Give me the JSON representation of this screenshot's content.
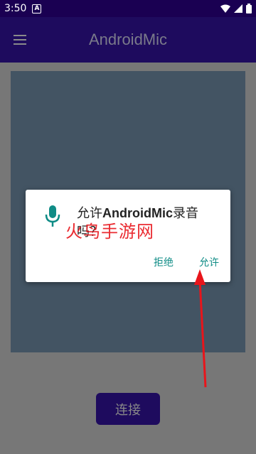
{
  "status_bar": {
    "time": "3:50",
    "notification_icon": "a-badge-icon",
    "icons": [
      "wifi-icon",
      "signal-icon",
      "battery-icon"
    ]
  },
  "app_bar": {
    "title": "AndroidMic",
    "menu_icon": "hamburger-menu-icon"
  },
  "dialog": {
    "icon": "microphone-icon",
    "message_prefix": "允许",
    "message_app": "AndroidMic",
    "message_suffix": "录音吗？",
    "deny_label": "拒绝",
    "allow_label": "允许"
  },
  "main": {
    "connect_label": "连接"
  },
  "overlay": {
    "watermark_text": "火鸟手游网"
  },
  "colors": {
    "app_bar": "#1e0b5e",
    "status_bar": "#1a0052",
    "panel": "#435463",
    "accent": "#0f8c86",
    "arrow": "#e8151b"
  }
}
